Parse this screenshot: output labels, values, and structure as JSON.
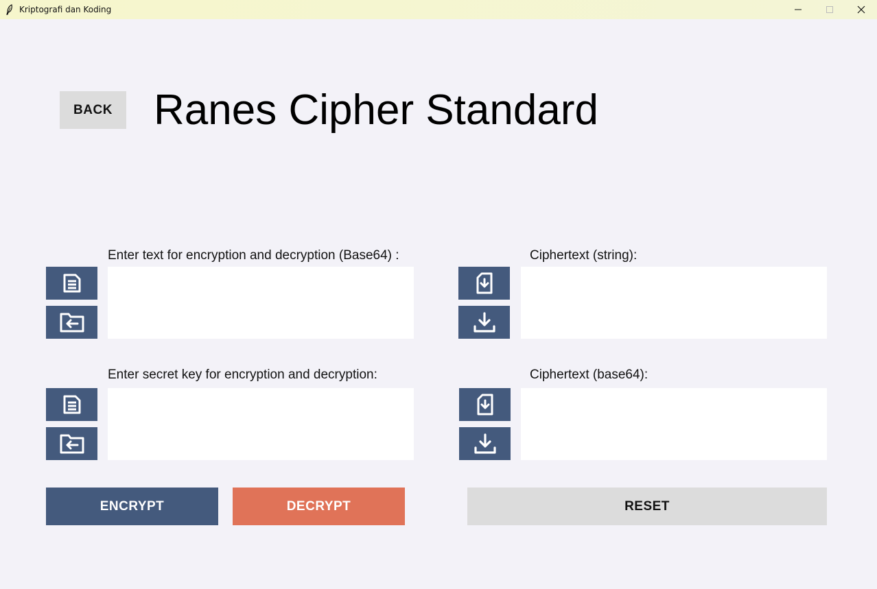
{
  "window": {
    "title": "Kriptografi dan Koding",
    "controls": [
      "minimize",
      "maximize",
      "close"
    ]
  },
  "header": {
    "back_label": "BACK",
    "page_title": "Ranes Cipher Standard"
  },
  "left_panel": {
    "text_input": {
      "label": "Enter text for encryption and decryption (Base64) :",
      "value": "",
      "buttons": [
        {
          "icon": "document-text-icon",
          "action": "input text"
        },
        {
          "icon": "folder-open-icon",
          "action": "open file"
        }
      ]
    },
    "key_input": {
      "label": "Enter secret key for encryption and decryption:",
      "value": "",
      "buttons": [
        {
          "icon": "document-text-icon",
          "action": "input text"
        },
        {
          "icon": "folder-open-icon",
          "action": "open file"
        }
      ]
    }
  },
  "right_panel": {
    "cipher_string": {
      "label": "Ciphertext (string):",
      "value": "",
      "buttons": [
        {
          "icon": "file-download-icon",
          "action": "save file"
        },
        {
          "icon": "download-icon",
          "action": "download"
        }
      ]
    },
    "cipher_base64": {
      "label": "Ciphertext (base64):",
      "value": "",
      "buttons": [
        {
          "icon": "file-download-icon",
          "action": "save file"
        },
        {
          "icon": "download-icon",
          "action": "download"
        }
      ]
    }
  },
  "actions": {
    "encrypt_label": "ENCRYPT",
    "decrypt_label": "DECRYPT",
    "reset_label": "RESET"
  },
  "colors": {
    "primary": "#445a7d",
    "accent": "#e07358",
    "neutral": "#dcdcdc",
    "background": "#f3f2f8"
  }
}
